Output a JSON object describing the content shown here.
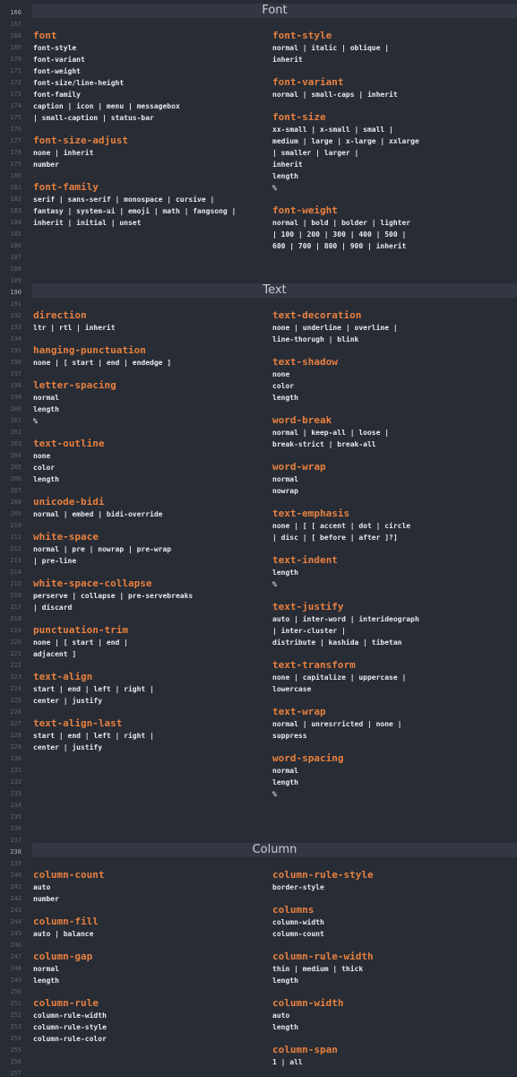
{
  "gutter": {
    "first_line": 166,
    "last_line": 257,
    "current_lines": [
      166,
      190,
      238
    ]
  },
  "sections": [
    {
      "title": "Font",
      "line": 166,
      "entries": [
        {
          "col": 1,
          "line": 168,
          "prop": "font",
          "values": [
            "font-style",
            "font-variant",
            "font-weight",
            "font-size/line-height",
            "font-family",
            "caption | icon | menu | messagebox",
            "| small-caption | status-bar"
          ]
        },
        {
          "col": 1,
          "line": 177,
          "prop": "font-size-adjust",
          "values": [
            "none | inherit",
            "number"
          ]
        },
        {
          "col": 1,
          "line": 181,
          "prop": "font-family",
          "values": [
            "serif | sans-serif | monospace | cursive |",
            "fantasy | system-ui | emoji | math | fangsong |",
            "inherit | initial | unset"
          ]
        },
        {
          "col": 2,
          "line": 168,
          "prop": "font-style",
          "values": [
            "normal | italic | oblique |",
            "inherit"
          ]
        },
        {
          "col": 2,
          "line": 172,
          "prop": "font-variant",
          "values": [
            "normal | small-caps | inherit"
          ]
        },
        {
          "col": 2,
          "line": 175,
          "prop": "font-size",
          "values": [
            "xx-small | x-small | small |",
            "medium | large | x-large | xxlarge",
            "| smaller | larger |",
            "inherit",
            "length",
            "%"
          ]
        },
        {
          "col": 2,
          "line": 183,
          "prop": "font-weight",
          "values": [
            "normal | bold | bolder | lighter",
            "| 100 | 200 | 300 | 400 | 500 |",
            "600 | 700 | 800 | 900 | inherit"
          ]
        }
      ]
    },
    {
      "title": "Text",
      "line": 190,
      "entries": [
        {
          "col": 1,
          "line": 192,
          "prop": "direction",
          "values": [
            "ltr | rtl | inherit"
          ]
        },
        {
          "col": 1,
          "line": 195,
          "prop": "hanging-punctuation",
          "values": [
            "none | [ start | end | endedge ]"
          ]
        },
        {
          "col": 1,
          "line": 198,
          "prop": "letter-spacing",
          "values": [
            "normal",
            "length",
            "%"
          ]
        },
        {
          "col": 1,
          "line": 203,
          "prop": "text-outline",
          "values": [
            "none",
            "color",
            "length"
          ]
        },
        {
          "col": 1,
          "line": 208,
          "prop": "unicode-bidi",
          "values": [
            "normal | embed | bidi-override"
          ]
        },
        {
          "col": 1,
          "line": 211,
          "prop": "white-space",
          "values": [
            "normal | pre | nowrap | pre-wrap",
            "| pre-line"
          ]
        },
        {
          "col": 1,
          "line": 215,
          "prop": "white-space-collapse",
          "values": [
            "perserve | collapse | pre-servebreaks",
            "| discard"
          ]
        },
        {
          "col": 1,
          "line": 219,
          "prop": "punctuation-trim",
          "values": [
            "none | [ start | end |",
            "adjacent ]"
          ]
        },
        {
          "col": 1,
          "line": 223,
          "prop": "text-align",
          "values": [
            "start | end | left | right |",
            "center | justify"
          ]
        },
        {
          "col": 1,
          "line": 227,
          "prop": "text-align-last",
          "values": [
            "start | end | left | right |",
            "center | justify"
          ]
        },
        {
          "col": 2,
          "line": 192,
          "prop": "text-decoration",
          "values": [
            "none | underline | overline |",
            "line-thorugh | blink"
          ]
        },
        {
          "col": 2,
          "line": 196,
          "prop": "text-shadow",
          "values": [
            "none",
            "color",
            "length"
          ]
        },
        {
          "col": 2,
          "line": 201,
          "prop": "word-break",
          "values": [
            "normal | keep-all | loose |",
            "break-strict | break-all"
          ]
        },
        {
          "col": 2,
          "line": 205,
          "prop": "word-wrap",
          "values": [
            "normal",
            "nowrap"
          ]
        },
        {
          "col": 2,
          "line": 209,
          "prop": "text-emphasis",
          "values": [
            "none | [ [ accent | dot | circle",
            "| disc | [ before | after ]?]"
          ]
        },
        {
          "col": 2,
          "line": 213,
          "prop": "text-indent",
          "values": [
            "length",
            "%"
          ]
        },
        {
          "col": 2,
          "line": 217,
          "prop": "text-justify",
          "values": [
            "auto | inter-word | interideograph",
            "| inter-cluster |",
            "distribute | kashida | tibetan"
          ]
        },
        {
          "col": 2,
          "line": 222,
          "prop": "text-transform",
          "values": [
            "none | capitalize | uppercase |",
            "lowercase"
          ]
        },
        {
          "col": 2,
          "line": 226,
          "prop": "text-wrap",
          "values": [
            "normal | unresrricted | none |",
            "suppress"
          ]
        },
        {
          "col": 2,
          "line": 230,
          "prop": "word-spacing",
          "values": [
            "normal",
            "length",
            "%"
          ]
        }
      ]
    },
    {
      "title": "Column",
      "line": 238,
      "entries": [
        {
          "col": 1,
          "line": 240,
          "prop": "column-count",
          "values": [
            "auto",
            "number"
          ]
        },
        {
          "col": 1,
          "line": 244,
          "prop": "column-fill",
          "values": [
            "auto | balance"
          ]
        },
        {
          "col": 1,
          "line": 247,
          "prop": "column-gap",
          "values": [
            "normal",
            "length"
          ]
        },
        {
          "col": 1,
          "line": 251,
          "prop": "column-rule",
          "values": [
            "column-rule-width",
            "column-rule-style",
            "column-rule-color"
          ]
        },
        {
          "col": 2,
          "line": 240,
          "prop": "column-rule-style",
          "values": [
            "border-style"
          ]
        },
        {
          "col": 2,
          "line": 243,
          "prop": "columns",
          "values": [
            "column-width",
            "column-count"
          ]
        },
        {
          "col": 2,
          "line": 247,
          "prop": "column-rule-width",
          "values": [
            "thin | medium | thick",
            "length"
          ]
        },
        {
          "col": 2,
          "line": 251,
          "prop": "column-width",
          "values": [
            "auto",
            "length"
          ]
        },
        {
          "col": 2,
          "line": 255,
          "prop": "column-span",
          "values": [
            "1 | all"
          ]
        }
      ]
    }
  ]
}
